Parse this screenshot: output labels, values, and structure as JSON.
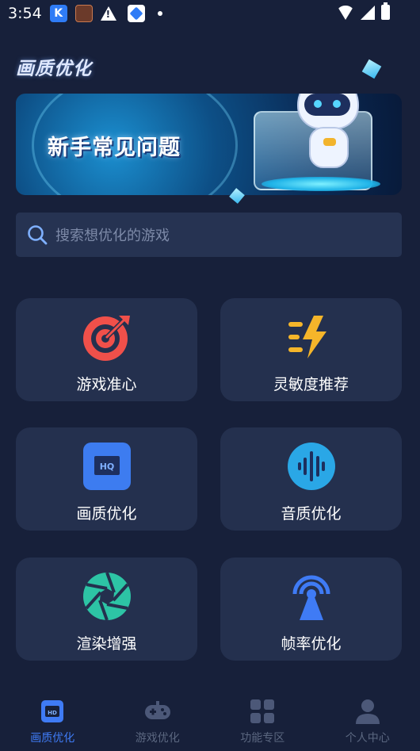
{
  "status_bar": {
    "time": "3:54"
  },
  "page": {
    "title": "画质优化"
  },
  "banner": {
    "text": "新手常见问题"
  },
  "search": {
    "placeholder": "搜索想优化的游戏"
  },
  "features": [
    {
      "label": "游戏准心",
      "icon": "crosshair-target-icon",
      "color": "#f0504a"
    },
    {
      "label": "灵敏度推荐",
      "icon": "lightning-icon",
      "color": "#f5b52a"
    },
    {
      "label": "画质优化",
      "icon": "hd-icon",
      "color": "#3d7cf0"
    },
    {
      "label": "音质优化",
      "icon": "sound-wave-icon",
      "color": "#2aa7e6"
    },
    {
      "label": "渲染增强",
      "icon": "aperture-icon",
      "color": "#2dc4a5"
    },
    {
      "label": "帧率优化",
      "icon": "signal-tower-icon",
      "color": "#3f7bf5"
    }
  ],
  "bottom_nav": {
    "items": [
      {
        "label": "画质优化",
        "icon": "hd-icon",
        "active": true
      },
      {
        "label": "游戏优化",
        "icon": "gamepad-icon",
        "active": false
      },
      {
        "label": "功能专区",
        "icon": "grid-icon",
        "active": false
      },
      {
        "label": "个人中心",
        "icon": "person-icon",
        "active": false
      }
    ]
  },
  "colors": {
    "background": "#17203a",
    "card": "#24304e",
    "accent": "#3f7bf5",
    "nav_inactive": "#5b6780"
  }
}
